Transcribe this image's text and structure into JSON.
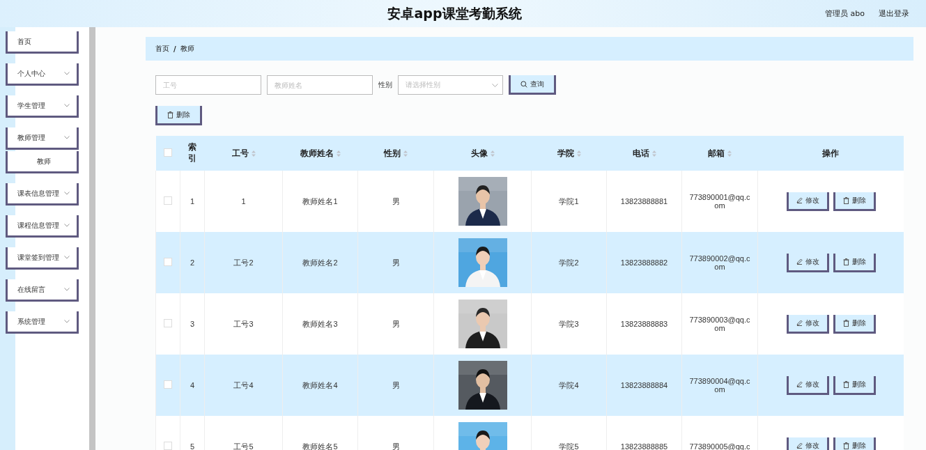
{
  "header": {
    "title": "安卓app课堂考勤系统",
    "user": "管理员 abo",
    "logout": "退出登录"
  },
  "sidebar": {
    "items": [
      {
        "label": "首页",
        "expandable": false
      },
      {
        "label": "个人中心",
        "expandable": true
      },
      {
        "label": "学生管理",
        "expandable": true
      },
      {
        "label": "教师管理",
        "expandable": true,
        "children": [
          {
            "label": "教师"
          }
        ]
      },
      {
        "label": "课表信息管理",
        "expandable": true
      },
      {
        "label": "课程信息管理",
        "expandable": true
      },
      {
        "label": "课堂签到管理",
        "expandable": true
      },
      {
        "label": "在线留言",
        "expandable": true
      },
      {
        "label": "系统管理",
        "expandable": true
      }
    ]
  },
  "breadcrumb": [
    "首页",
    "教师"
  ],
  "breadcrumb_separator": "/",
  "search": {
    "fields": [
      {
        "placeholder": "工号"
      },
      {
        "placeholder": "教师姓名"
      }
    ],
    "gender_label": "性别",
    "gender_placeholder": "请选择性别",
    "button": "查询"
  },
  "bulk_delete": "删除",
  "table": {
    "select_all_checked": false,
    "columns": [
      {
        "label": "索引",
        "sortable": false
      },
      {
        "label": "工号",
        "sortable": true
      },
      {
        "label": "教师姓名",
        "sortable": true
      },
      {
        "label": "性别",
        "sortable": true
      },
      {
        "label": "头像",
        "sortable": true
      },
      {
        "label": "学院",
        "sortable": true
      },
      {
        "label": "电话",
        "sortable": true
      },
      {
        "label": "邮箱",
        "sortable": true
      },
      {
        "label": "操作",
        "sortable": false
      }
    ],
    "rows": [
      {
        "checked": false,
        "index": "1",
        "id": "1",
        "name": "教师姓名1",
        "gender": "男",
        "college": "学院1",
        "phone": "13823888881",
        "email": "773890001@qq.com",
        "actions": [
          "修改",
          "删除"
        ]
      },
      {
        "checked": false,
        "index": "2",
        "id": "工号2",
        "name": "教师姓名2",
        "gender": "男",
        "college": "学院2",
        "phone": "13823888882",
        "email": "773890002@qq.com",
        "actions": [
          "修改",
          "删除"
        ]
      },
      {
        "checked": false,
        "index": "3",
        "id": "工号3",
        "name": "教师姓名3",
        "gender": "男",
        "college": "学院3",
        "phone": "13823888883",
        "email": "773890003@qq.com",
        "actions": [
          "修改",
          "删除"
        ]
      },
      {
        "checked": false,
        "index": "4",
        "id": "工号4",
        "name": "教师姓名4",
        "gender": "男",
        "college": "学院4",
        "phone": "13823888884",
        "email": "773890004@qq.com",
        "actions": [
          "修改",
          "删除"
        ]
      },
      {
        "checked": false,
        "index": "5",
        "id": "工号5",
        "name": "教师姓名5",
        "gender": "男",
        "college": "学院5",
        "phone": "13823888885",
        "email": "773890005@qq.c",
        "actions": [
          "修改",
          "删除"
        ]
      }
    ]
  }
}
